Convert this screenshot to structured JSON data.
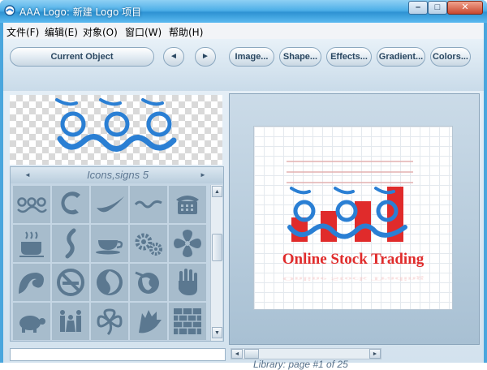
{
  "window": {
    "title": "AAA Logo: 新建 Logo 项目",
    "buttons": {
      "minimize": "–",
      "maximize": "□",
      "close": "✕"
    }
  },
  "menu": [
    {
      "label": "文件(F)"
    },
    {
      "label": "编辑(E)"
    },
    {
      "label": "对象(O)"
    },
    {
      "label": "窗口(W)"
    },
    {
      "label": "帮助(H)"
    }
  ],
  "toolbar": {
    "current_object": "Current Object",
    "prev": "◄",
    "next": "►",
    "image": "Image...",
    "shape": "Shape...",
    "effects": "Effects...",
    "gradient": "Gradient...",
    "colors": "Colors..."
  },
  "library": {
    "category": "Icons,signs 5",
    "prev_arrow": "◄",
    "next_arrow": "►",
    "icons": [
      "swirl-logo-icon",
      "circle-swoosh-icon",
      "check-swoosh-icon",
      "wave-icon",
      "telephone-icon",
      "coffee-cup-icon",
      "s-curve-icon",
      "tea-cup-icon",
      "gears-icon",
      "spiral-flower-icon",
      "wave-curl-icon",
      "no-smoking-icon",
      "moon-face-icon",
      "globe-icon",
      "hand-print-icon",
      "turtle-icon",
      "family-icon",
      "clover-icon",
      "feather-fan-icon",
      "brick-wall-icon"
    ],
    "status": "Library: page #1 of 25"
  },
  "canvas": {
    "logo_text": "Online Stock Trading"
  },
  "colors": {
    "logo_blue": "#2a7fd4",
    "logo_red": "#e02b2b",
    "icon_fill": "#5b7890",
    "icon_bg": "#a7bccc"
  },
  "scrollbars": {
    "up": "▲",
    "down": "▼",
    "left": "◄",
    "right": "►"
  }
}
